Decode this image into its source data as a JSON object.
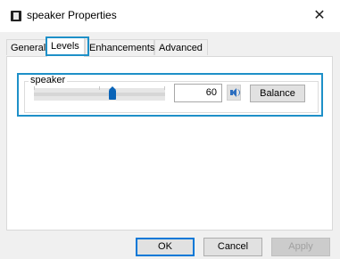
{
  "window": {
    "title": "speaker Properties",
    "close_glyph": "✕"
  },
  "tabs": [
    {
      "label": "General"
    },
    {
      "label": "Levels"
    },
    {
      "label": "Enhancements"
    },
    {
      "label": "Advanced"
    }
  ],
  "selected_tab": "Levels",
  "level": {
    "group_label": "speaker",
    "volume_value": "60",
    "slider_fraction": 0.6,
    "mute_icon": "speaker-volume-icon",
    "balance_label": "Balance"
  },
  "footer": {
    "ok_label": "OK",
    "cancel_label": "Cancel",
    "apply_label": "Apply"
  },
  "colors": {
    "highlight": "#1e90c8",
    "thumb": "#0a64b8",
    "dialog_bg": "#f0f0f0"
  }
}
